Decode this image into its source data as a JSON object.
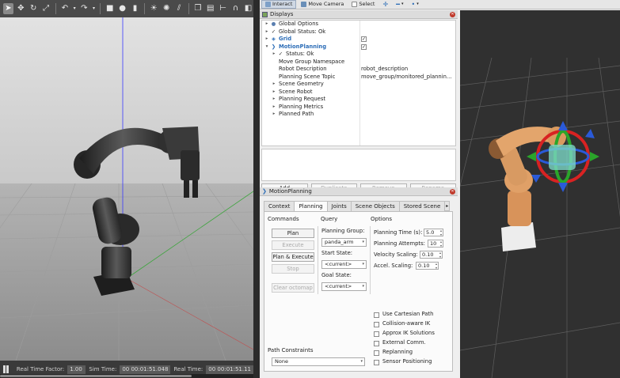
{
  "gazebo": {
    "toolbar_icons": [
      "select-arrow-icon",
      "move-icon",
      "rotate-icon",
      "scale-icon",
      "undo-icon",
      "undo-dropdown-icon",
      "redo-icon",
      "redo-dropdown-icon",
      "box-icon",
      "sphere-icon",
      "cylinder-icon",
      "sun-icon",
      "spot-light-icon",
      "directional-light-icon",
      "copy-icon",
      "paste-icon",
      "align-icon",
      "snap-icon",
      "view-angle-icon"
    ],
    "status": {
      "real_time_factor_label": "Real Time Factor:",
      "real_time_factor_value": "1.00",
      "sim_time_label": "Sim Time:",
      "sim_time_value": "00 00:01:51.048",
      "real_time_label": "Real Time:",
      "real_time_value": "00 00:01:51.11"
    }
  },
  "rviz": {
    "toolbar": [
      {
        "label": "Interact",
        "active": true
      },
      {
        "label": "Move Camera",
        "active": false
      },
      {
        "label": "Select",
        "active": false
      }
    ],
    "displays": {
      "title": "Displays",
      "tree": [
        {
          "label": "Global Options",
          "indent": 0,
          "arrow": "▸",
          "icon": "globe-icon",
          "glyph": "●",
          "value": ""
        },
        {
          "label": "Global Status: Ok",
          "indent": 0,
          "arrow": "▸",
          "icon": "check-icon",
          "glyph": "✓",
          "value": ""
        },
        {
          "label": "Grid",
          "indent": 0,
          "arrow": "▸",
          "icon": "grid-icon",
          "glyph": "◈",
          "value": "",
          "checked": true,
          "style": "blue-bold"
        },
        {
          "label": "MotionPlanning",
          "indent": 0,
          "arrow": "▾",
          "icon": "motion-planning-icon",
          "glyph": "❯",
          "value": "",
          "checked": true,
          "style": "blue-bold"
        },
        {
          "label": "Status: Ok",
          "indent": 1,
          "arrow": "▸",
          "icon": "check-icon",
          "glyph": "✓",
          "value": ""
        },
        {
          "label": "Move Group Namespace",
          "indent": 1,
          "arrow": "",
          "icon": "",
          "glyph": "",
          "value": ""
        },
        {
          "label": "Robot Description",
          "indent": 1,
          "arrow": "",
          "icon": "",
          "glyph": "",
          "value": "robot_description"
        },
        {
          "label": "Planning Scene Topic",
          "indent": 1,
          "arrow": "",
          "icon": "",
          "glyph": "",
          "value": "move_group/monitored_plannin..."
        },
        {
          "label": "Scene Geometry",
          "indent": 1,
          "arrow": "▸",
          "icon": "",
          "glyph": "",
          "value": ""
        },
        {
          "label": "Scene Robot",
          "indent": 1,
          "arrow": "▸",
          "icon": "",
          "glyph": "",
          "value": ""
        },
        {
          "label": "Planning Request",
          "indent": 1,
          "arrow": "▸",
          "icon": "",
          "glyph": "",
          "value": ""
        },
        {
          "label": "Planning Metrics",
          "indent": 1,
          "arrow": "▸",
          "icon": "",
          "glyph": "",
          "value": ""
        },
        {
          "label": "Planned Path",
          "indent": 1,
          "arrow": "▸",
          "icon": "",
          "glyph": "",
          "value": ""
        }
      ],
      "buttons": [
        {
          "label": "Add",
          "enabled": true
        },
        {
          "label": "Duplicate",
          "enabled": false
        },
        {
          "label": "Remove",
          "enabled": false
        },
        {
          "label": "Rename",
          "enabled": false
        }
      ]
    },
    "motion_planning": {
      "title": "MotionPlanning",
      "tabs": [
        "Context",
        "Planning",
        "Joints",
        "Scene Objects",
        "Stored Scene"
      ],
      "active_tab": "Planning",
      "commands_title": "Commands",
      "commands": [
        {
          "label": "Plan",
          "enabled": true
        },
        {
          "label": "Execute",
          "enabled": false
        },
        {
          "label": "Plan & Execute",
          "enabled": true
        },
        {
          "label": "Stop",
          "enabled": false
        },
        {
          "label": "Clear octomap",
          "enabled": false
        }
      ],
      "query_title": "Query",
      "planning_group_label": "Planning Group:",
      "planning_group_value": "panda_arm",
      "start_state_label": "Start State:",
      "start_state_value": "<current>",
      "goal_state_label": "Goal State:",
      "goal_state_value": "<current>",
      "options_title": "Options",
      "options": [
        {
          "label": "Planning Time (s):",
          "value": "5.0"
        },
        {
          "label": "Planning Attempts:",
          "value": "10"
        },
        {
          "label": "Velocity Scaling:",
          "value": "0.10"
        },
        {
          "label": "Accel. Scaling:",
          "value": "0.10"
        }
      ],
      "checkboxes": [
        {
          "label": "Use Cartesian Path",
          "checked": false
        },
        {
          "label": "Collision-aware IK",
          "checked": false
        },
        {
          "label": "Approx IK Solutions",
          "checked": false
        },
        {
          "label": "External Comm.",
          "checked": false
        },
        {
          "label": "Replanning",
          "checked": false
        },
        {
          "label": "Sensor Positioning",
          "checked": false
        }
      ],
      "path_constraints_title": "Path Constraints",
      "path_constraints_value": "None"
    }
  }
}
